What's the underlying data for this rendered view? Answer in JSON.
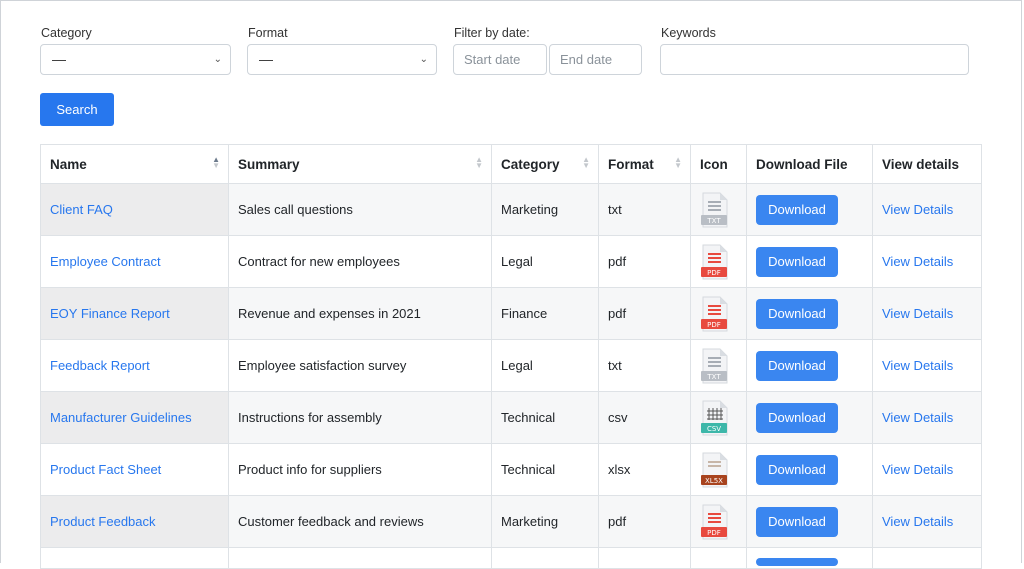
{
  "filters": {
    "category": {
      "label": "Category",
      "value": "—"
    },
    "format": {
      "label": "Format",
      "value": "—"
    },
    "date": {
      "label": "Filter by date:",
      "start_placeholder": "Start date",
      "end_placeholder": "End date"
    },
    "keywords": {
      "label": "Keywords",
      "value": ""
    },
    "search_label": "Search"
  },
  "table": {
    "headers": {
      "name": "Name",
      "summary": "Summary",
      "category": "Category",
      "format": "Format",
      "icon": "Icon",
      "download": "Download File",
      "details": "View details"
    },
    "rows": [
      {
        "name": "Client FAQ",
        "summary": "Sales call questions",
        "category": "Marketing",
        "format": "txt",
        "icon": "txt-file-icon",
        "icon_label": "TXT",
        "download": "Download",
        "details": "View Details"
      },
      {
        "name": "Employee Contract",
        "summary": "Contract for new employees",
        "category": "Legal",
        "format": "pdf",
        "icon": "pdf-file-icon",
        "icon_label": "PDF",
        "download": "Download",
        "details": "View Details"
      },
      {
        "name": "EOY Finance Report",
        "summary": "Revenue and expenses in 2021",
        "category": "Finance",
        "format": "pdf",
        "icon": "pdf-file-icon",
        "icon_label": "PDF",
        "download": "Download",
        "details": "View Details"
      },
      {
        "name": "Feedback Report",
        "summary": "Employee satisfaction survey",
        "category": "Legal",
        "format": "txt",
        "icon": "txt-file-icon",
        "icon_label": "TXT",
        "download": "Download",
        "details": "View Details"
      },
      {
        "name": "Manufacturer Guidelines",
        "summary": "Instructions for assembly",
        "category": "Technical",
        "format": "csv",
        "icon": "csv-file-icon",
        "icon_label": "CSV",
        "download": "Download",
        "details": "View Details"
      },
      {
        "name": "Product Fact Sheet",
        "summary": "Product info for suppliers",
        "category": "Technical",
        "format": "xlsx",
        "icon": "xlsx-file-icon",
        "icon_label": "XL5X",
        "download": "Download",
        "details": "View Details"
      },
      {
        "name": "Product Feedback",
        "summary": "Customer feedback and reviews",
        "category": "Marketing",
        "format": "pdf",
        "icon": "pdf-file-icon",
        "icon_label": "PDF",
        "download": "Download",
        "details": "View Details"
      }
    ]
  },
  "colors": {
    "accent": "#2777ee",
    "pdf": "#e84a3f",
    "txt": "#b9bec5",
    "csv": "#3db7a9",
    "xlsx": "#a8431e"
  }
}
